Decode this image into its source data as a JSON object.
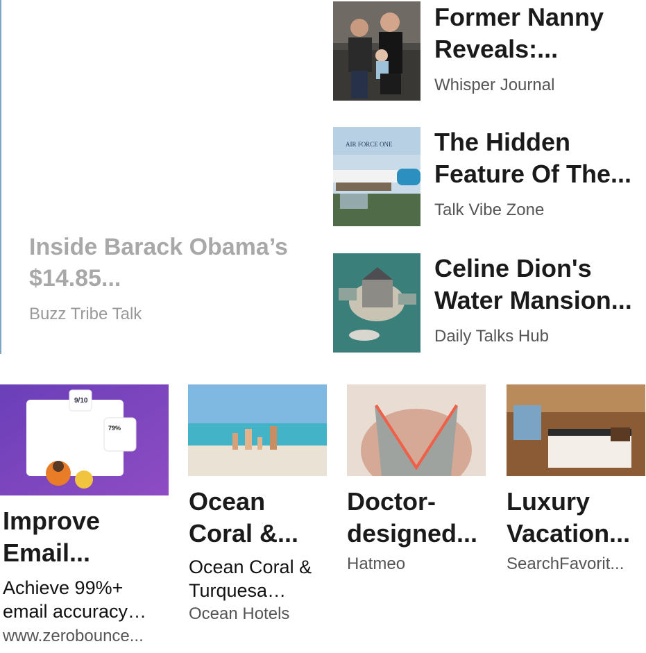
{
  "featured": {
    "title": "Inside Barack Obama’s $14.85...",
    "source": "Buzz Tribe Talk"
  },
  "side_items": [
    {
      "title": "Former Nanny Reveals:...",
      "source": "Whisper Journal",
      "image": "family-photo"
    },
    {
      "title": "The Hidden Feature Of The...",
      "source": "Talk Vibe Zone",
      "image": "air-force-one-diagram"
    },
    {
      "title": "Celine Dion's Water Mansion...",
      "source": "Daily Talks Hub",
      "image": "island-mansion"
    }
  ],
  "cards": [
    {
      "title": "Improve Email...",
      "desc": "Achieve 99%+ email accuracy…",
      "source": "www.zerobounce...",
      "image": "email-validator-dashboard",
      "score": "9/10",
      "percent": "79%"
    },
    {
      "title": "Ocean Coral &...",
      "desc": "Ocean Coral & Turquesa…",
      "source": "Ocean Hotels",
      "image": "beach-family"
    },
    {
      "title": "Doctor-designed...",
      "source": "Hatmeo",
      "image": "back-bra"
    },
    {
      "title": "Luxury Vacation...",
      "source": "SearchFavorit...",
      "image": "train-bedroom"
    }
  ]
}
